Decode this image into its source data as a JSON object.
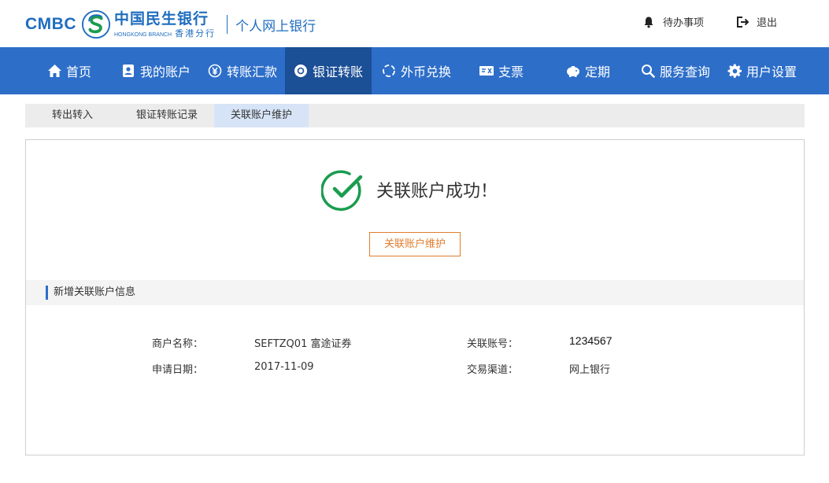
{
  "header": {
    "brand_en": "CMBC",
    "brand_cn": "中国民生银行",
    "branch_en": "HONGKONG BRANCH",
    "branch_cn": "香港分行",
    "portal_title": "个人网上银行",
    "todo_label": "待办事项",
    "todo_icon": "bell-icon",
    "logout_label": "退出",
    "logout_icon": "logout-icon"
  },
  "nav": {
    "background": "#2d6ec9",
    "active_background": "#1b4f96",
    "items": [
      {
        "label": "首页",
        "icon": "home-icon"
      },
      {
        "label": "我的账户",
        "icon": "account-card-icon"
      },
      {
        "label": "转账汇款",
        "icon": "yen-circle-icon"
      },
      {
        "label": "银证转账",
        "icon": "disc-icon",
        "active": true
      },
      {
        "label": "外币兑换",
        "icon": "exchange-circle-icon"
      },
      {
        "label": "支票",
        "icon": "cheque-icon"
      },
      {
        "label": "定期",
        "icon": "piggy-bank-icon"
      },
      {
        "label": "服务查询",
        "icon": "search-icon"
      },
      {
        "label": "用户设置",
        "icon": "gear-icon"
      }
    ]
  },
  "subtabs": [
    {
      "label": "转出转入"
    },
    {
      "label": "银证转账记录"
    },
    {
      "label": "关联账户维护",
      "active": true
    }
  ],
  "result": {
    "icon": "success-check-icon",
    "icon_color": "#1a9c4f",
    "title": "关联账户成功！",
    "button_label": "关联账户维护",
    "button_color": "#e07d2c"
  },
  "section": {
    "title": "新增关联账户信息"
  },
  "info": {
    "merchant_label": "商户名称：",
    "merchant_value": "SEFTZQ01 富途证券",
    "account_label": "关联账号：",
    "account_value": "1234567",
    "date_label": "申请日期：",
    "date_value": "2017-11-09",
    "channel_label": "交易渠道：",
    "channel_value": "网上银行"
  }
}
